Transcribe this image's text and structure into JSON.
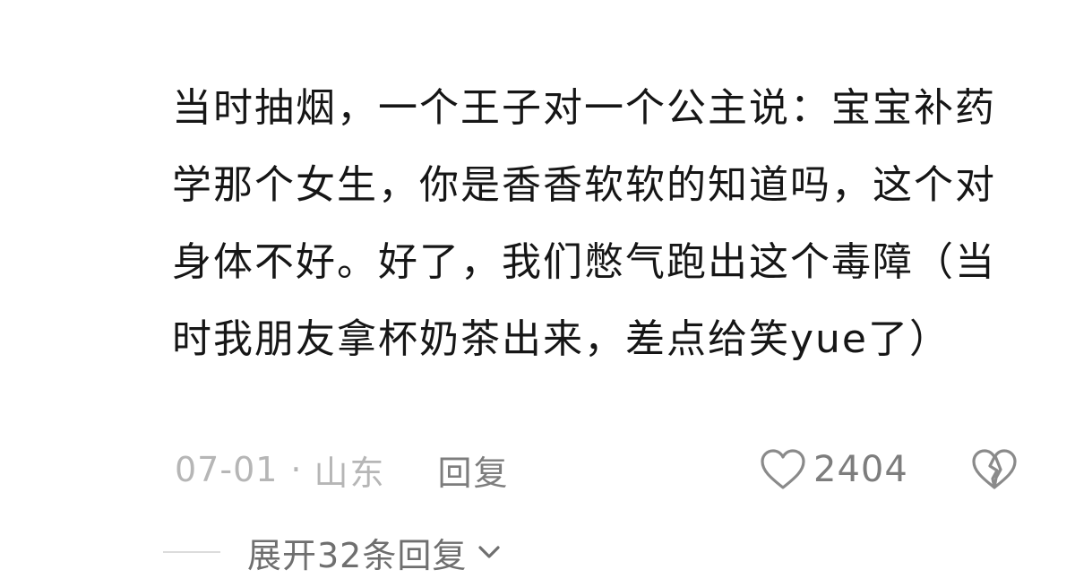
{
  "comment": {
    "text": "当时抽烟，一个王子对一个公主说：宝宝补药学那个女生，你是香香软软的知道吗，这个对身体不好。好了，我们憋气跑出这个毒障（当时我朋友拿杯奶茶出来，差点给笑yue了）",
    "date": "07-01",
    "separator": "·",
    "location": "山东",
    "reply_label": "回复",
    "likes": "2404"
  },
  "replies": {
    "expand_label": "展开32条回复"
  },
  "icons": {
    "like": "heart-outline-icon",
    "dislike": "broken-heart-icon",
    "expand": "chevron-down-icon"
  },
  "colors": {
    "text": "#161616",
    "meta": "#b6b6b6",
    "action": "#7d7d7d"
  }
}
